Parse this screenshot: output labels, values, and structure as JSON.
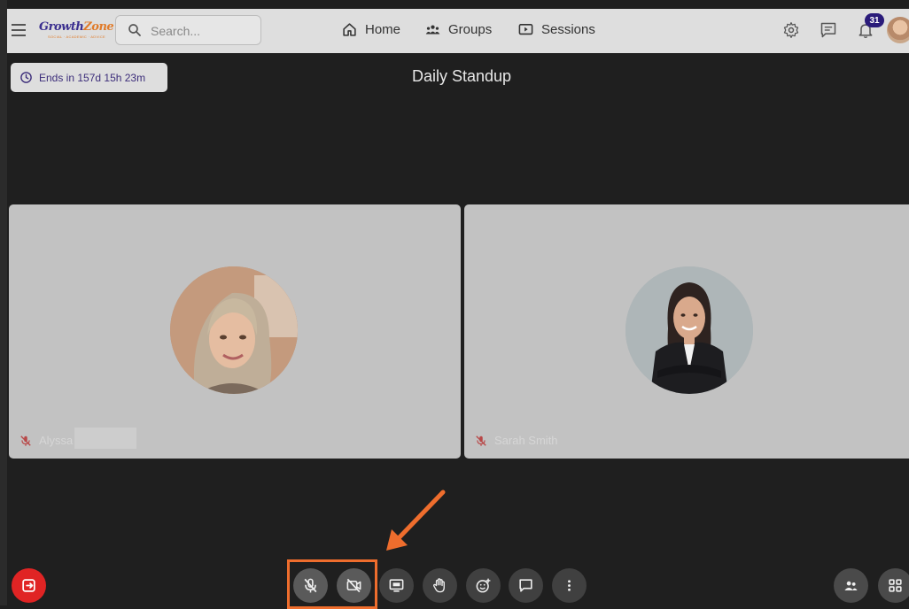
{
  "nav": {
    "logo_text": "Growth",
    "logo_text_accent": "Zone",
    "logo_tagline": "SOCIAL · ACADEMIC · ADVICE",
    "search_placeholder": "Search...",
    "links": [
      {
        "label": "Home",
        "icon": "home-icon"
      },
      {
        "label": "Groups",
        "icon": "groups-icon"
      },
      {
        "label": "Sessions",
        "icon": "sessions-icon"
      }
    ],
    "notification_count": "31"
  },
  "session": {
    "timer_text": "Ends in 157d 15h 23m",
    "title": "Daily Standup"
  },
  "participants": [
    {
      "name": "Alyssa",
      "muted": true
    },
    {
      "name": "Sarah Smith",
      "muted": true
    }
  ],
  "controls": [
    {
      "name": "leave-button",
      "icon": "exit-icon"
    },
    {
      "name": "mute-mic-button",
      "icon": "mic-off-icon"
    },
    {
      "name": "camera-off-button",
      "icon": "camera-off-icon"
    },
    {
      "name": "share-screen-button",
      "icon": "screen-share-icon"
    },
    {
      "name": "raise-hand-button",
      "icon": "hand-icon"
    },
    {
      "name": "reaction-button",
      "icon": "emoji-icon"
    },
    {
      "name": "chat-button",
      "icon": "chat-icon"
    },
    {
      "name": "more-button",
      "icon": "more-vertical-icon"
    },
    {
      "name": "participants-button",
      "icon": "people-icon"
    },
    {
      "name": "layout-button",
      "icon": "grid-icon"
    }
  ],
  "colors": {
    "background": "#1f1f1f",
    "nav_bg": "#dedede",
    "tile_bg": "#c2c2c2",
    "leave_red": "#e02424",
    "highlight_orange": "#ee6d2d",
    "brand_purple": "#3b2f8f",
    "badge_purple": "#2a1b7a"
  }
}
